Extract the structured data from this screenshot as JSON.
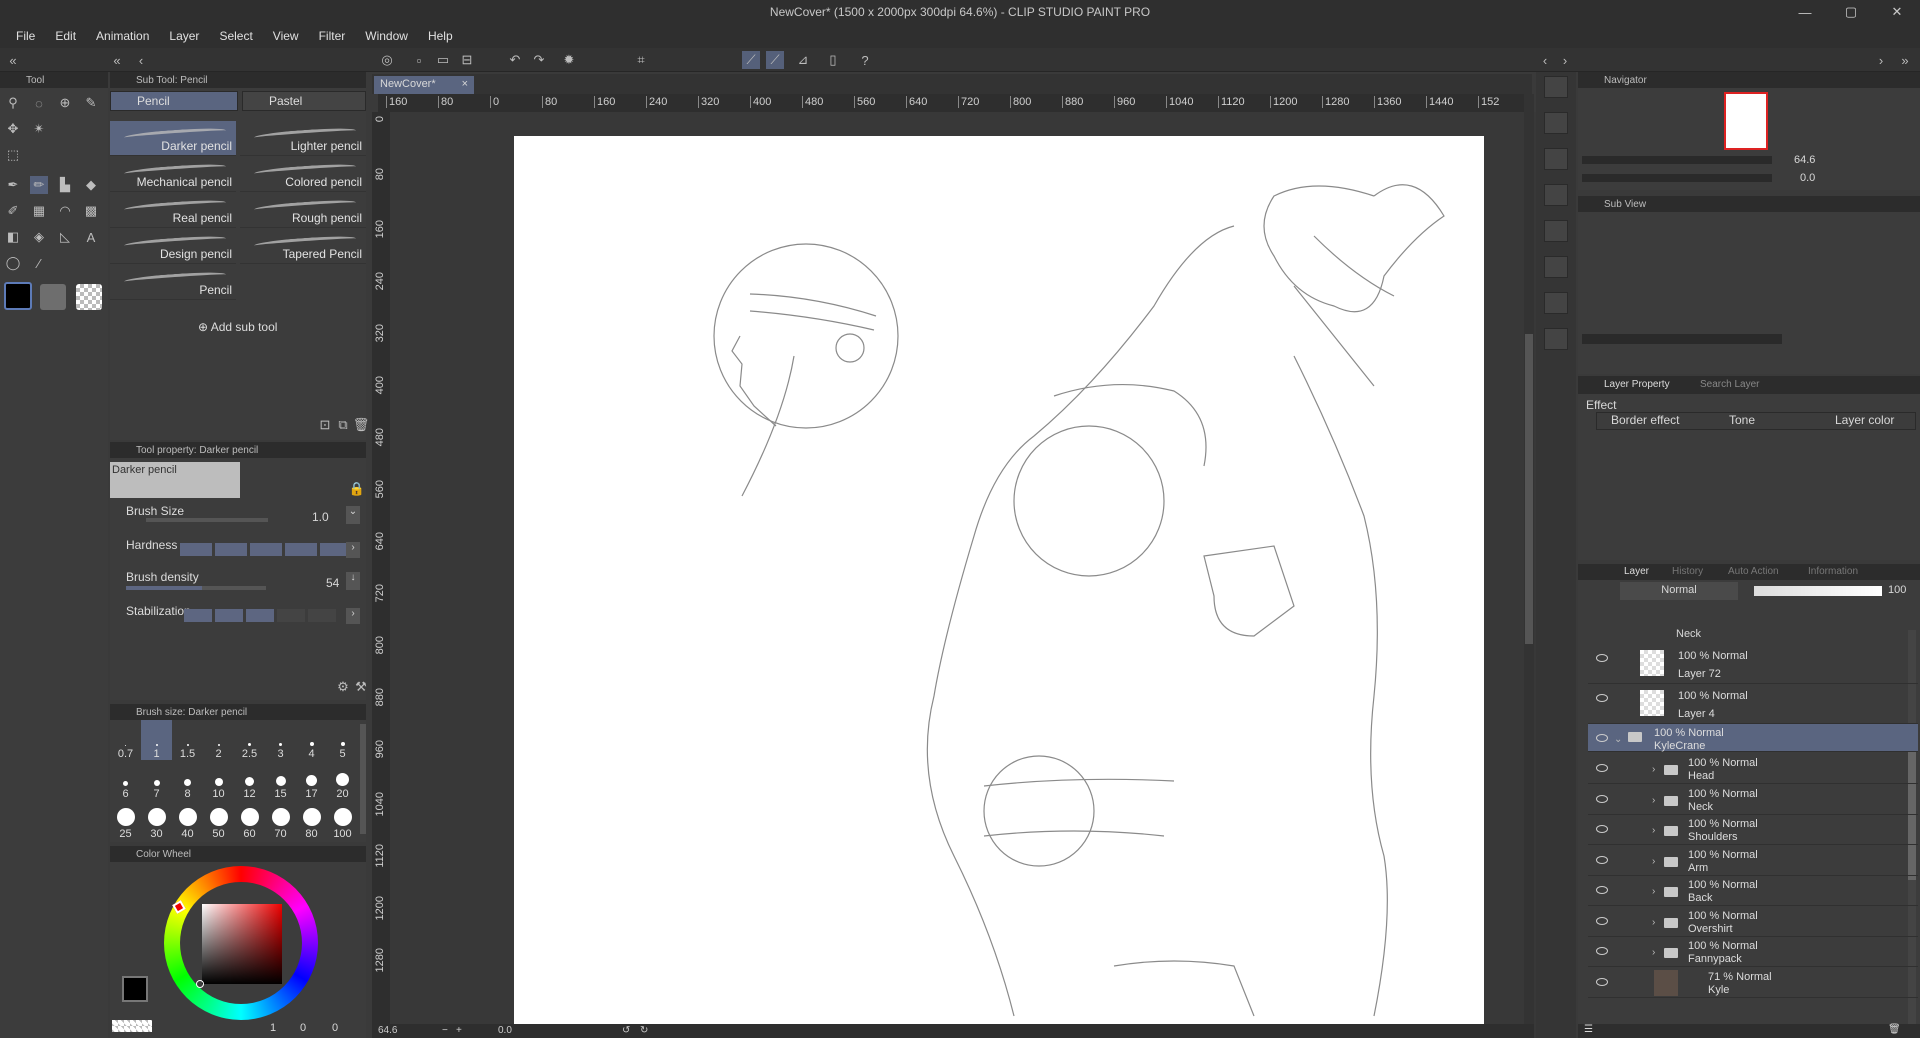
{
  "window": {
    "title": "NewCover* (1500 x 2000px 300dpi 64.6%) - CLIP STUDIO PAINT PRO",
    "controls": [
      "—",
      "▢",
      "✕"
    ]
  },
  "menu": [
    "File",
    "Edit",
    "Animation",
    "Layer",
    "Select",
    "View",
    "Filter",
    "Window",
    "Help"
  ],
  "tool_panel": {
    "header": "Tool"
  },
  "sub_tool_panel": {
    "header": "Sub Tool: Pencil",
    "tabs": [
      "Pencil",
      "Pastel"
    ],
    "brushes": [
      "Darker pencil",
      "Lighter pencil",
      "Mechanical pencil",
      "Colored pencil",
      "Real pencil",
      "Rough pencil",
      "Design pencil",
      "Tapered Pencil",
      "Pencil"
    ],
    "add_label": "Add sub tool"
  },
  "tool_property": {
    "header": "Tool property: Darker pencil",
    "preview_label": "Darker pencil",
    "brush_size_label": "Brush Size",
    "brush_size_value": "1.0",
    "hardness_label": "Hardness",
    "hardness_level": 5,
    "brush_density_label": "Brush density",
    "brush_density_value": "54",
    "stabilization_label": "Stabilization",
    "stabilization_level": 3
  },
  "brush_size_panel": {
    "header": "Brush size: Darker pencil",
    "sizes": [
      "0.7",
      "1",
      "1.5",
      "2",
      "2.5",
      "3",
      "4",
      "5",
      "6",
      "7",
      "8",
      "10",
      "12",
      "15",
      "17",
      "20",
      "25",
      "30",
      "40",
      "50",
      "60",
      "70",
      "80",
      "100"
    ],
    "selected": "1"
  },
  "color_panel": {
    "header": "Color Wheel",
    "main_color": "#000000",
    "sub_color": "#7a7a7a",
    "readout": [
      "1",
      "0",
      "0"
    ]
  },
  "document_tab": "NewCover*",
  "ruler_top": [
    "160",
    "80",
    "0",
    "80",
    "160",
    "240",
    "320",
    "400",
    "480",
    "560",
    "640",
    "720",
    "800",
    "880",
    "960",
    "1040",
    "1120",
    "1200",
    "1280",
    "1360",
    "1440",
    "152"
  ],
  "ruler_left": [
    "0",
    "80",
    "160",
    "240",
    "320",
    "400",
    "480",
    "560",
    "640",
    "720",
    "800",
    "880",
    "960",
    "1040",
    "1120",
    "1200",
    "1280"
  ],
  "status": {
    "zoom": "64.6",
    "rotation": "0.0"
  },
  "navigator": {
    "header": "Navigator",
    "zoom_value": "64.6",
    "rotate_value": "0.0"
  },
  "sub_view": {
    "header": "Sub View"
  },
  "layer_property": {
    "tab": "Layer Property",
    "tab2": "Search Layer",
    "effect_label": "Effect",
    "effects": [
      "Border effect",
      "Tone",
      "Layer color"
    ]
  },
  "layer_panel": {
    "tabs": [
      "Layer",
      "History",
      "Auto Action",
      "Information"
    ],
    "blend_mode": "Normal",
    "opacity": "100",
    "partial_top": "Neck",
    "rows": [
      {
        "type": "layer",
        "mode": "100 % Normal",
        "name": "Layer 72"
      },
      {
        "type": "layer",
        "mode": "100 % Normal",
        "name": "Layer 4"
      },
      {
        "type": "group-open",
        "mode": "100 % Normal",
        "name": "KyleCrane"
      },
      {
        "type": "group",
        "mode": "100 % Normal",
        "name": "Head"
      },
      {
        "type": "group",
        "mode": "100 % Normal",
        "name": "Neck"
      },
      {
        "type": "group",
        "mode": "100 % Normal",
        "name": "Shoulders"
      },
      {
        "type": "group",
        "mode": "100 % Normal",
        "name": "Arm"
      },
      {
        "type": "group",
        "mode": "100 % Normal",
        "name": "Back"
      },
      {
        "type": "group",
        "mode": "100 % Normal",
        "name": "Overshirt"
      },
      {
        "type": "group",
        "mode": "100 % Normal",
        "name": "Fannypack"
      },
      {
        "type": "image",
        "mode": "71 % Normal",
        "name": "Kyle"
      }
    ]
  }
}
